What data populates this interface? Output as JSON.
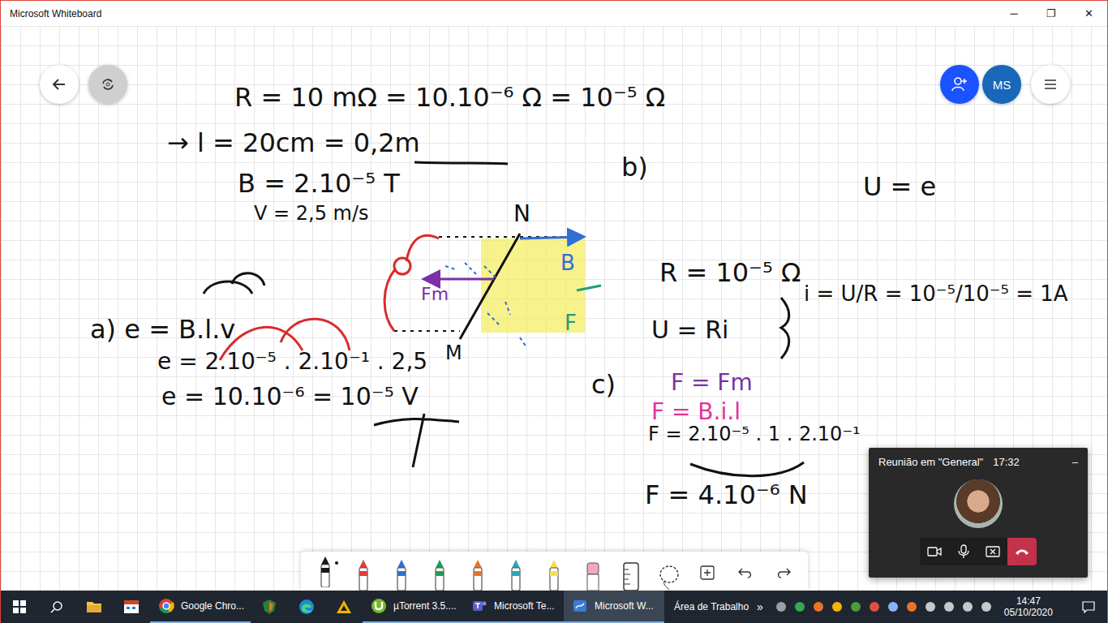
{
  "window": {
    "title": "Microsoft Whiteboard",
    "controls": [
      "─",
      "❐",
      "✕"
    ]
  },
  "header": {
    "avatar": "MS"
  },
  "ink": [
    {
      "text": "R = 10 mΩ = 10.10⁻⁶ Ω = 10⁻⁵ Ω",
      "color": "#111111"
    },
    {
      "text": "→ l = 20cm = 0,2m",
      "color": "#111111"
    },
    {
      "text": "B = 2.10⁻⁵ T",
      "color": "#111111"
    },
    {
      "text": "V = 2,5 m/s",
      "color": "#111111"
    },
    {
      "text": "a)  e = B.l.v",
      "color": "#111111"
    },
    {
      "text": "e = 2.10⁻⁵ . 2.10⁻¹ . 2,5",
      "color": "#111111"
    },
    {
      "text": "e  =   10.10⁻⁶ = 10⁻⁵ V",
      "color": "#111111"
    },
    {
      "text": "b)",
      "color": "#111111"
    },
    {
      "text": "U = e",
      "color": "#111111"
    },
    {
      "text": "R = 10⁻⁵ Ω",
      "color": "#111111"
    },
    {
      "text": "U = Ri",
      "color": "#111111"
    },
    {
      "text": "i = U/R = 10⁻⁵/10⁻⁵ = 1A",
      "color": "#111111"
    },
    {
      "text": "c)",
      "color": "#111111"
    },
    {
      "text": "F = Fm",
      "color": "#7b2fa8"
    },
    {
      "text": "F = B.i.l",
      "color": "#e0359a"
    },
    {
      "text": "F = 2.10⁻⁵ . 1 . 2.10⁻¹",
      "color": "#111111"
    },
    {
      "text": "F = 4.10⁻⁶ N",
      "color": "#111111"
    },
    {
      "text": "N",
      "color": "#111111"
    },
    {
      "text": "M",
      "color": "#111111"
    },
    {
      "text": "B",
      "color": "#2f6fd6"
    },
    {
      "text": "F",
      "color": "#1f9d7e"
    },
    {
      "text": "Fm",
      "color": "#7b2fa8"
    }
  ],
  "toolbar": {
    "pens": [
      {
        "color": "#1a1a1a",
        "selected": true
      },
      {
        "color": "#e23b3b",
        "selected": false
      },
      {
        "color": "#2f6fd6",
        "selected": false
      },
      {
        "color": "#1f9d55",
        "selected": false
      },
      {
        "color": "#e8742a",
        "selected": false
      },
      {
        "color": "#2aa7b8",
        "selected": false
      },
      {
        "color": "#f4e04d",
        "selected": false
      }
    ]
  },
  "meeting": {
    "title": "Reunião em \"General\"",
    "time": "17:32",
    "minimize": "–"
  },
  "taskbar": {
    "apps": [
      {
        "label": "Google Chro...",
        "selected": false
      },
      {
        "label": "µTorrent 3.5....",
        "selected": false
      },
      {
        "label": "Microsoft Te...",
        "selected": false
      },
      {
        "label": "Microsoft W...",
        "selected": true
      }
    ],
    "more": "»",
    "desktop": "Área de Trabalho",
    "time": "14:47",
    "date": "05/10/2020"
  }
}
